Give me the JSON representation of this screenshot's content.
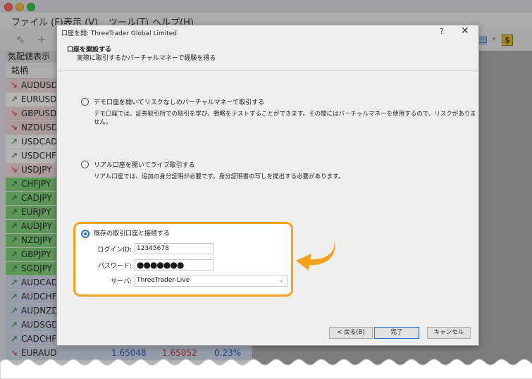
{
  "menu": [
    "ファイル (F)",
    "表示 (V)",
    "ツール(T)",
    "ヘルプ(H)"
  ],
  "market_watch": {
    "title": "気配値表示",
    "col_symbol": "銘柄",
    "rows": [
      {
        "symbol": "AUDUSD",
        "trend": "down"
      },
      {
        "symbol": "EURUSD",
        "trend": "up-pale"
      },
      {
        "symbol": "GBPUSD",
        "trend": "down"
      },
      {
        "symbol": "NZDUSD",
        "trend": "down"
      },
      {
        "symbol": "USDCAD",
        "trend": "up-pale"
      },
      {
        "symbol": "USDCHF",
        "trend": "up-pale"
      },
      {
        "symbol": "USDJPY",
        "trend": "down"
      },
      {
        "symbol": "CHFJPY",
        "trend": "up-green"
      },
      {
        "symbol": "CADJPY",
        "trend": "up-green"
      },
      {
        "symbol": "EURJPY",
        "trend": "up-green"
      },
      {
        "symbol": "AUDJPY",
        "trend": "up-green"
      },
      {
        "symbol": "NZDJPY",
        "trend": "up-green"
      },
      {
        "symbol": "GBPJPY",
        "trend": "up-green"
      },
      {
        "symbol": "SGDJPY",
        "trend": "up-green"
      },
      {
        "symbol": "AUDCAD",
        "trend": "blue"
      },
      {
        "symbol": "AUDCHF",
        "trend": "blue"
      },
      {
        "symbol": "AUDNZD",
        "trend": "blue"
      },
      {
        "symbol": "AUDSGD",
        "trend": "blue"
      },
      {
        "symbol": "CADCHF",
        "trend": "blue"
      }
    ],
    "last_row": {
      "symbol": "EURAUD",
      "bid": "1.65048",
      "ask": "1.65052",
      "change": "0.23%"
    }
  },
  "dialog": {
    "title": "口座を開: ThreeTrader Global Limited",
    "help": "?",
    "close": "✕",
    "heading": "口座を開設する",
    "subheading": "実際に取引するかバーチャルマネーで経験を得る",
    "option_demo": {
      "label": "デモ口座を開いてリスクなしのバーチャルマネーで取引する",
      "desc": "デモ口座では、証券取引所での取引を学び、戦略をテストすることができます。その間にはバーチャルマネーを使用するので、リスクがありません。"
    },
    "option_real": {
      "label": "リアル口座を開いてライブ取引する",
      "desc": "リアル口座では、追加の身分証明が必要です。身分証明書の写しを提出する必要があります。"
    },
    "option_existing": {
      "label": "既存の取引口座と接続する",
      "login_label": "ログインID:",
      "login_value": "12345678",
      "password_label": "パスワード:",
      "password_value": "●●●●●●●",
      "server_label": "サーバ:",
      "server_value": "ThreeTrader-Live"
    },
    "buttons": {
      "back": "< 戻る(B)",
      "finish": "完了",
      "cancel": "キャンセル"
    }
  },
  "colors": {
    "highlight": "#f5a21b",
    "radio_selected": "#1d6fd1"
  }
}
